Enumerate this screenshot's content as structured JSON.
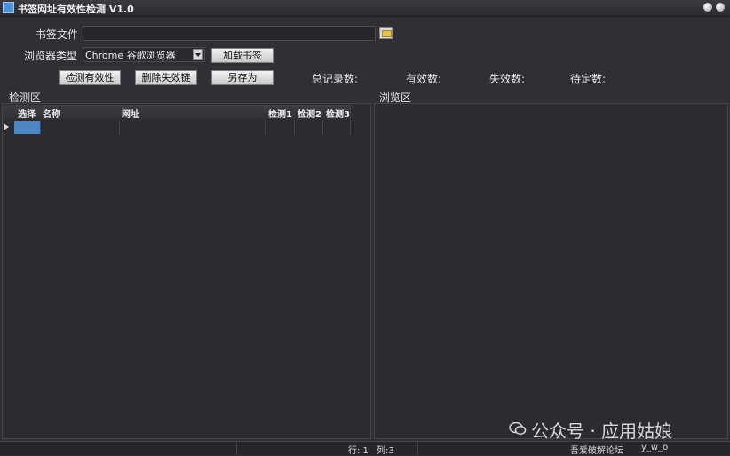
{
  "title": "书签网址有效性检测 V1.0",
  "form": {
    "bookmark_file_label": "书签文件",
    "bookmark_file_value": "",
    "browser_type_label": "浏览器类型",
    "browser_selected": "Chrome 谷歌浏览器"
  },
  "buttons": {
    "load_bookmarks": "加载书签",
    "check_validity": "检测有效性",
    "delete_dead_links": "删除失效链",
    "save_as": "另存为"
  },
  "stats": {
    "total_label": "总记录数:",
    "valid_label": "有效数:",
    "invalid_label": "失效数:",
    "pending_label": "待定数:"
  },
  "panels": {
    "detect_label": "检测区",
    "browse_label": "浏览区"
  },
  "grid": {
    "columns": [
      "选择",
      "名称",
      "网址",
      "检测1",
      "检测2",
      "检测3"
    ]
  },
  "status": {
    "row": "行: 1",
    "col": "列:3",
    "site": "吾爱破解论坛",
    "user": "y_w_o"
  },
  "watermark": "公众号 · 应用姑娘",
  "colors": {
    "background": "#2f3035",
    "selection": "#4e86c4"
  }
}
